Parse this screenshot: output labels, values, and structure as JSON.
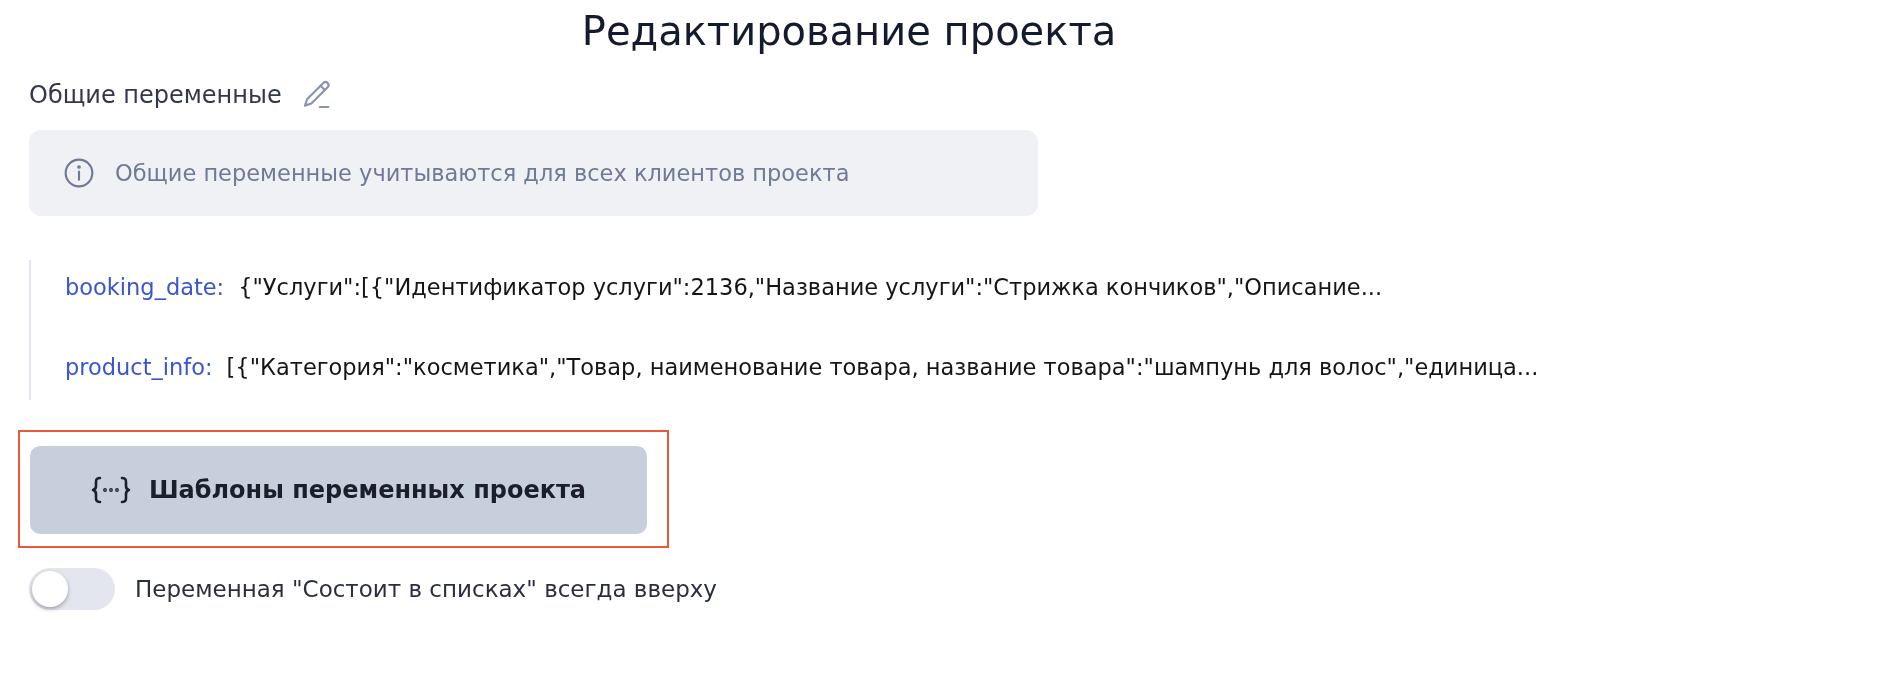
{
  "title": "Редактирование проекта",
  "section": {
    "label": "Общие переменные",
    "info": "Общие переменные учитываются для всех клиентов проекта"
  },
  "variables": [
    {
      "name": "booking_date:",
      "value": "{\"Услуги\":[{\"Идентификатор услуги\":2136,\"Название услуги\":\"Стрижка кончиков\",\"Описание..."
    },
    {
      "name": "product_info:",
      "value": "[{\"Категория\":\"косметика\",\"Товар, наименование товара, название товара\":\"шампунь для волос\",\"единица..."
    }
  ],
  "templates_button": {
    "label": "Шаблоны переменных проекта",
    "highlighted": true
  },
  "toggle": {
    "label": "Переменная \"Состоит в списках\" всегда вверху",
    "on": false
  }
}
